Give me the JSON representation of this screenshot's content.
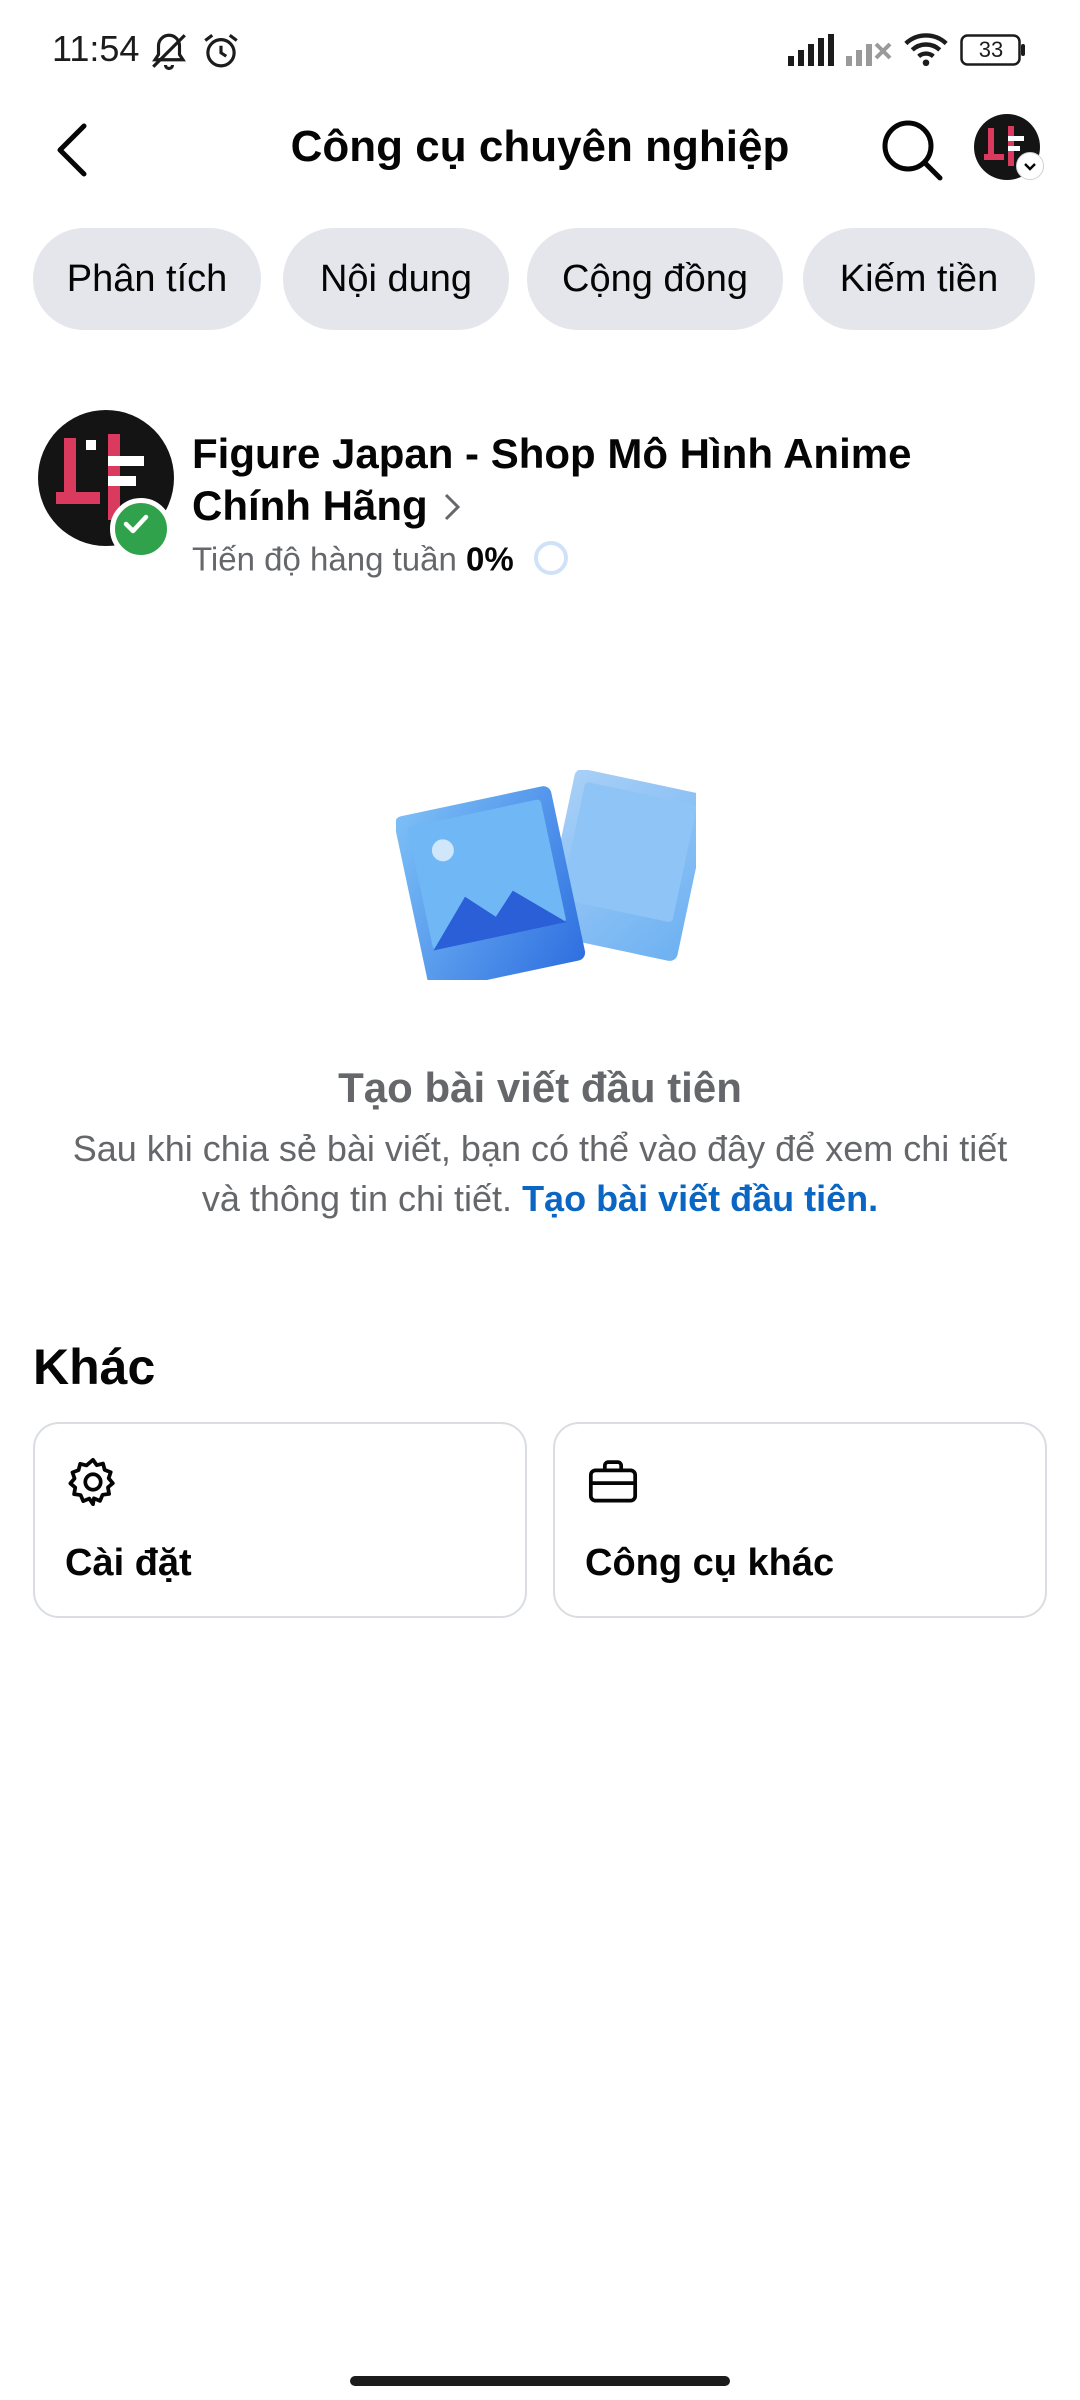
{
  "status_bar": {
    "time": "11:54",
    "battery": "33"
  },
  "header": {
    "title": "Công cụ chuyên nghiệp"
  },
  "chips": [
    {
      "label": "Phân tích"
    },
    {
      "label": "Nội dung"
    },
    {
      "label": "Cộng đồng"
    },
    {
      "label": "Kiếm tiền"
    }
  ],
  "profile": {
    "name": "Figure Japan - Shop Mô Hình Anime Chính Hãng",
    "progress_label": "Tiến độ hàng tuần",
    "progress_value": "0%",
    "progress_fraction": 0
  },
  "empty_state": {
    "title": "Tạo bài viết đầu tiên",
    "description": "Sau khi chia sẻ bài viết, bạn có thể vào đây để xem chi tiết và thông tin chi tiết.",
    "link": "Tạo bài viết đầu tiên."
  },
  "other": {
    "title": "Khác",
    "cards": [
      {
        "label": "Cài đặt",
        "icon": "gear-icon"
      },
      {
        "label": "Công cụ khác",
        "icon": "briefcase-icon"
      }
    ]
  },
  "colors": {
    "accent": "#0a66c2",
    "verified": "#31a24c",
    "chip_bg": "#e4e6eb",
    "muted": "#65676b"
  }
}
